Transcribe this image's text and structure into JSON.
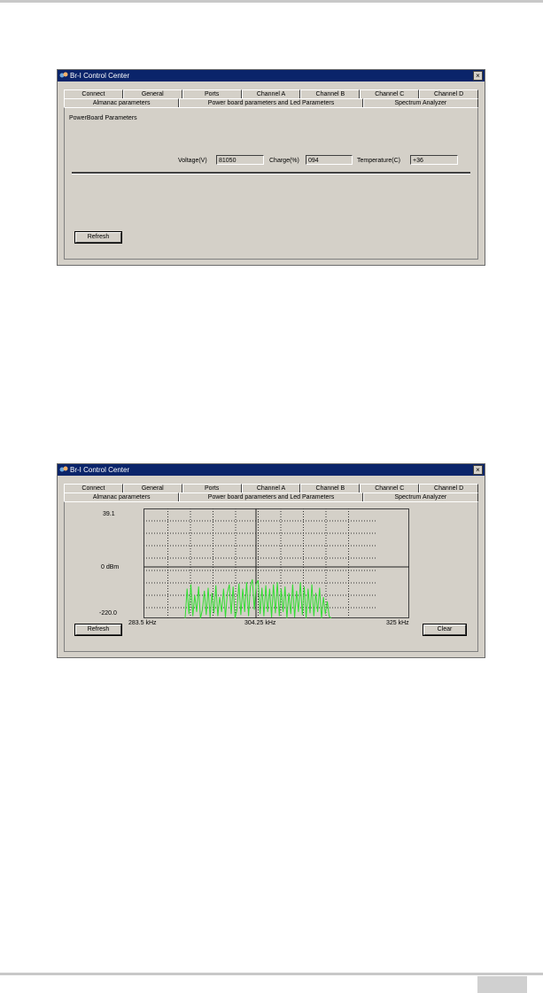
{
  "window1": {
    "title": "Br-I Control Center",
    "close_glyph": "×",
    "tabs_row1": [
      "Connect",
      "General",
      "Ports",
      "Channel A",
      "Channel B",
      "Channel C",
      "Channel D"
    ],
    "tabs_row2": [
      "Almanac parameters",
      "Power board parameters and Led Parameters",
      "Spectrum Analyzer"
    ],
    "active_tab": "Power board parameters and Led Parameters",
    "group_label": "PowerBoard Parameters",
    "voltage_label": "Voltage(V)",
    "voltage_value": "81050",
    "charge_label": "Charge(%)",
    "charge_value": "094",
    "temperature_label": "Temperature(C)",
    "temperature_value": "+36",
    "refresh_label": "Refresh"
  },
  "window2": {
    "title": "Br-I Control Center",
    "close_glyph": "×",
    "tabs_row1": [
      "Connect",
      "General",
      "Ports",
      "Channel A",
      "Channel B",
      "Channel C",
      "Channel D"
    ],
    "tabs_row2": [
      "Almanac parameters",
      "Power board parameters and Led Parameters",
      "Spectrum Analyzer"
    ],
    "active_tab": "Spectrum Analyzer",
    "y_top": "39.1",
    "y_mid": "0 dBm",
    "y_bottom": "-220.0",
    "x_left": "283.5 kHz",
    "x_mid": "304.25 kHz",
    "x_right": "325 kHz",
    "refresh_label": "Refresh",
    "clear_label": "Clear",
    "trace_color": "#33dd33"
  },
  "chart_data": {
    "type": "line",
    "xlabel": "",
    "ylabel": "",
    "xlim": [
      283.5,
      325
    ],
    "ylim": [
      -220.0,
      39.1
    ],
    "grid": true,
    "series": [
      {
        "color": "#33dd33",
        "x": [
          290.0,
          290.3,
          290.6,
          290.9,
          291.2,
          291.5,
          291.8,
          292.1,
          292.4,
          292.7,
          293.0,
          293.3,
          293.6,
          293.9,
          294.2,
          294.5,
          294.8,
          295.1,
          295.4,
          295.7,
          296.0,
          296.3,
          296.6,
          296.9,
          297.2,
          297.5,
          297.8,
          298.1,
          298.4,
          298.7,
          299.0,
          299.3,
          299.6,
          299.9,
          300.2,
          300.5,
          300.8,
          301.1,
          301.4,
          301.7,
          302.0,
          302.3,
          302.6,
          302.9,
          303.2,
          303.5,
          303.8,
          304.1,
          304.4,
          304.7,
          305.0,
          305.3,
          305.6,
          305.9,
          306.2,
          306.5,
          306.8,
          307.1,
          307.4,
          307.7,
          308.0,
          308.3,
          308.6,
          308.9,
          309.2,
          309.5,
          309.8,
          310.1,
          310.4,
          310.7,
          311.0,
          311.3,
          311.6,
          311.9,
          312.2,
          312.5,
          312.8
        ],
        "y": [
          -220,
          -150,
          -210,
          -140,
          -215,
          -165,
          -205,
          -145,
          -220,
          -200,
          -155,
          -212,
          -148,
          -218,
          -160,
          -208,
          -142,
          -215,
          -170,
          -205,
          -150,
          -218,
          -160,
          -140,
          -210,
          -145,
          -220,
          -200,
          -138,
          -212,
          -150,
          -205,
          -135,
          -215,
          -145,
          -128,
          -200,
          -140,
          -130,
          -210,
          -148,
          -215,
          -142,
          -205,
          -150,
          -218,
          -140,
          -208,
          -135,
          -215,
          -150,
          -205,
          -145,
          -220,
          -160,
          -210,
          -140,
          -218,
          -155,
          -205,
          -135,
          -212,
          -145,
          -220,
          -150,
          -208,
          -140,
          -215,
          -160,
          -205,
          -148,
          -220,
          -170,
          -210,
          -180,
          -215,
          -220
        ]
      }
    ]
  }
}
